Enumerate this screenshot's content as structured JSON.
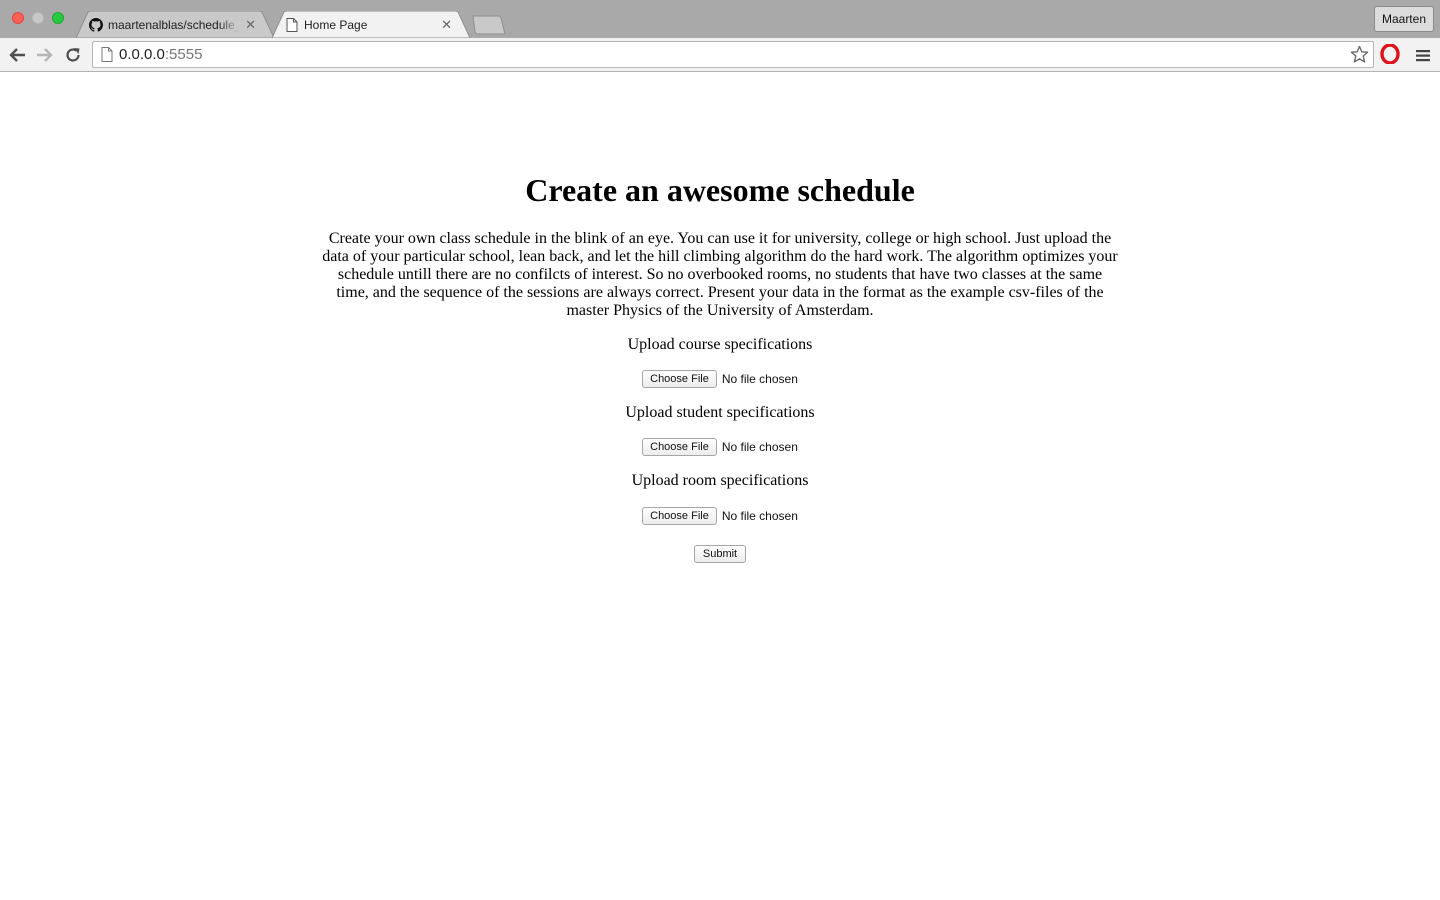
{
  "browser": {
    "tabs": [
      {
        "title": "maartenalblas/schedule_maker",
        "icon": "github-icon",
        "active": false
      },
      {
        "title": "Home Page",
        "icon": "page-icon",
        "active": true
      }
    ],
    "profile_name": "Maarten",
    "url_host": "0.0.0.0",
    "url_port": ":5555"
  },
  "page": {
    "title": "Create an awesome schedule",
    "intro": "Create your own class schedule in the blink of an eye. You can use it for university, college or high school. Just upload the data of your particular school, lean back, and let the hill climbing algorithm do the hard work. The algorithm optimizes your schedule untill there are no confilcts of interest. So no overbooked rooms, no students that have two classes at the same time, and the sequence of the sessions are always correct. Present your data in the format as the example csv-files of the master Physics of the University of Amsterdam.",
    "uploads": [
      {
        "label": "Upload course specifications",
        "button": "Choose File",
        "status": "No file chosen"
      },
      {
        "label": "Upload student specifications",
        "button": "Choose File",
        "status": "No file chosen"
      },
      {
        "label": "Upload room specifications",
        "button": "Choose File",
        "status": "No file chosen"
      }
    ],
    "submit_label": "Submit"
  }
}
